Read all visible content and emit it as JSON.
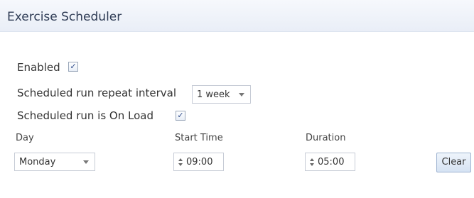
{
  "header": {
    "title": "Exercise Scheduler"
  },
  "enabled": {
    "label": "Enabled",
    "checked": true,
    "mark": "✓"
  },
  "repeat": {
    "label": "Scheduled run repeat interval",
    "value": "1 week"
  },
  "on_load": {
    "label": "Scheduled run is On Load",
    "checked": true,
    "mark": "✓"
  },
  "columns": {
    "day": "Day",
    "start_time": "Start Time",
    "duration": "Duration"
  },
  "row": {
    "day": "Monday",
    "start_time": "09:00",
    "duration": "05:00"
  },
  "buttons": {
    "clear": "Clear"
  }
}
